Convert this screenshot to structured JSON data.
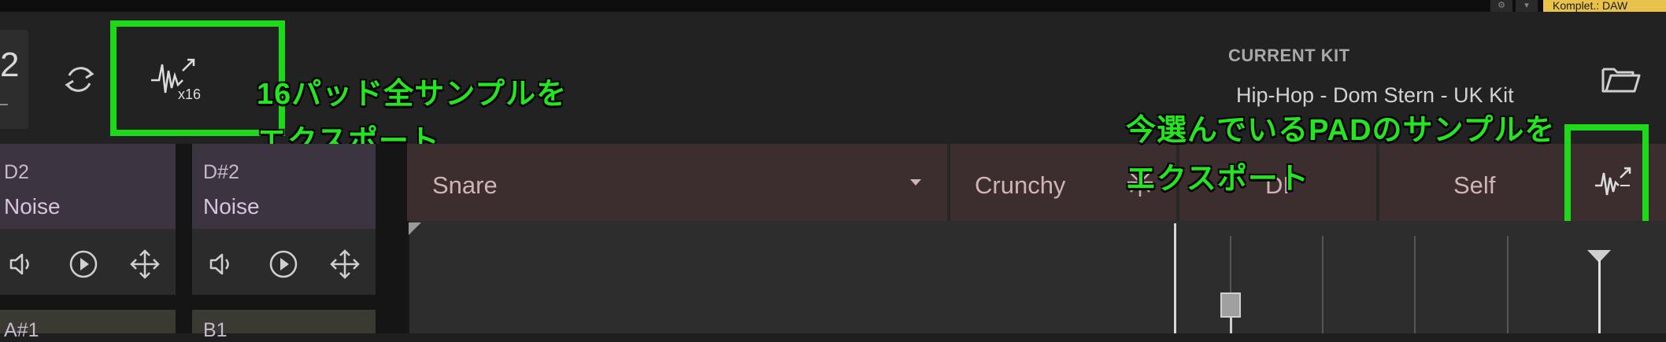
{
  "system_bar": {
    "settings_icon": "gear-icon",
    "dropdown_icon": "chevron-down-icon",
    "badge_text": "Komplet.: DAW"
  },
  "header": {
    "number_partial": "2",
    "refresh_icon": "refresh-icon",
    "export_all_icon": "waveform-export-icon",
    "export_all_sublabel": "x16",
    "current_kit_label": "CURRENT KIT",
    "current_kit_name": "Hip-Hop - Dom Stern - UK Kit",
    "folder_icon": "folder-icon"
  },
  "annotations": {
    "export_all_line1": "16パッド全サンプルを",
    "export_all_line2": "エクスポート",
    "export_pad_line1": "今選んでいるPADのサンプルを",
    "export_pad_line2": "エクスポート"
  },
  "pads": [
    {
      "note": "D2",
      "name": "Noise"
    },
    {
      "note": "D#2",
      "name": "Noise"
    },
    {
      "note": "A#1",
      "name": ""
    },
    {
      "note": "B1",
      "name": ""
    }
  ],
  "pad_controls": [
    "speaker-icon",
    "play-icon",
    "move-icon"
  ],
  "instrument_bar": {
    "type": "Snare",
    "character": "Crunchy",
    "tab3": "DI",
    "tab4": "Self"
  },
  "colors": {
    "annotation_green": "#1ed81a",
    "status_badge": "#e8c24a",
    "instrument_bar": "#3c2e2e",
    "pad_top": "#3c3440"
  }
}
